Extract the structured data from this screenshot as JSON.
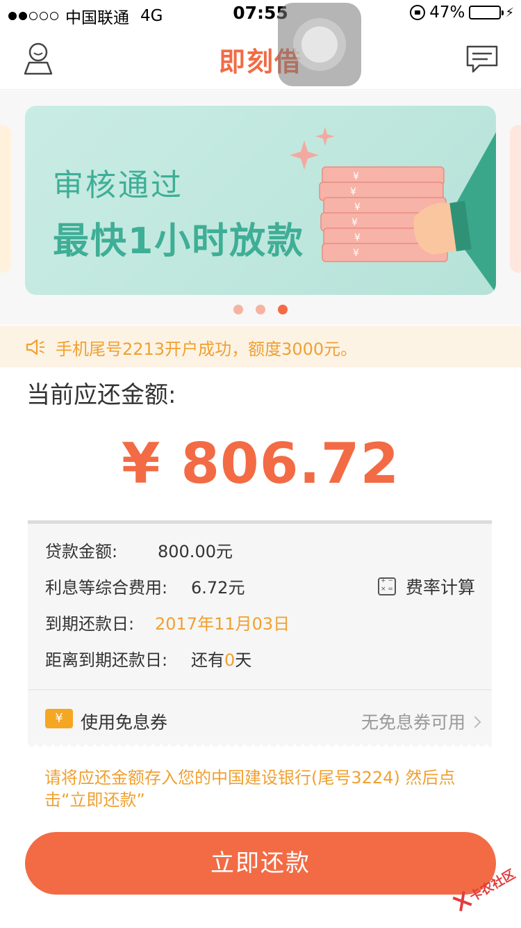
{
  "status_bar": {
    "carrier": "中国联通",
    "network": "4G",
    "time": "07:55",
    "battery_percent": "47%",
    "battery_level": 0.47
  },
  "header": {
    "title": "即刻借"
  },
  "banner": {
    "line1": "审核通过",
    "line2": "最快1小时放款",
    "page_count": 3,
    "active_page": 3
  },
  "notice": {
    "text": "手机尾号2213开户成功，额度3000元。"
  },
  "due": {
    "label": "当前应还金额:",
    "amount": "¥ 806.72"
  },
  "details": {
    "loan_amount_label": "贷款金额:",
    "loan_amount_value": "800.00元",
    "fees_label": "利息等综合费用:",
    "fees_value": "6.72元",
    "rate_calc_label": "费率计算",
    "due_date_label": "到期还款日:",
    "due_date_value": "2017年11月03日",
    "days_left_label": "距离到期还款日:",
    "days_left_prefix": "还有",
    "days_left_value": "0",
    "days_left_suffix": "天"
  },
  "coupon": {
    "icon_text": "¥",
    "label": "使用免息券",
    "status": "无免息券可用"
  },
  "instruction": "请将应还金额存入您的中国建设银行(尾号3224) 然后点击“立即还款”",
  "repay_button": "立即还款",
  "watermark": "卡农社区",
  "colors": {
    "brand": "#f26b45",
    "accent_orange": "#f0a030",
    "banner_green": "#3fae96"
  }
}
